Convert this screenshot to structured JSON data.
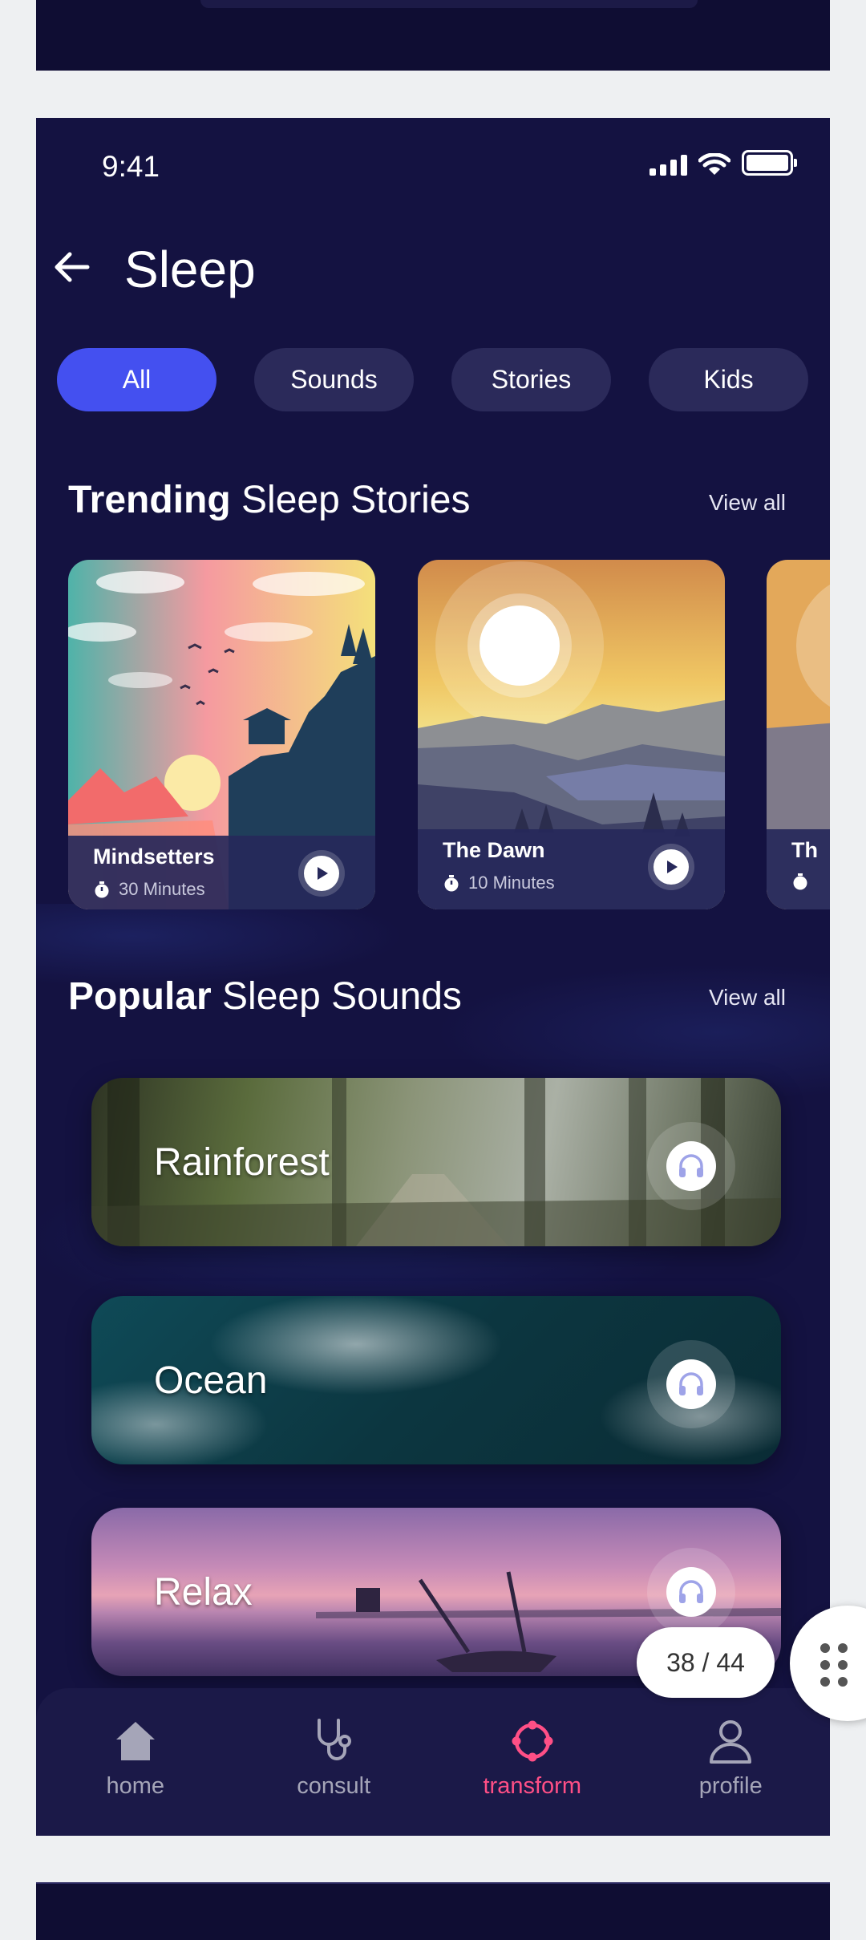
{
  "status": {
    "time": "9:41"
  },
  "header": {
    "title": "Sleep"
  },
  "chips": [
    {
      "label": "All",
      "active": true
    },
    {
      "label": "Sounds"
    },
    {
      "label": "Stories"
    },
    {
      "label": "Kids"
    }
  ],
  "trending": {
    "title_bold": "Trending",
    "title_rest": " Sleep Stories",
    "view_all": "View all",
    "items": [
      {
        "title": "Mindsetters",
        "duration": "30 Minutes"
      },
      {
        "title": "The Dawn",
        "duration": "10 Minutes"
      },
      {
        "title": "Th"
      }
    ]
  },
  "popular": {
    "title_bold": "Popular",
    "title_rest": " Sleep Sounds",
    "view_all": "View all",
    "items": [
      {
        "label": "Rainforest"
      },
      {
        "label": "Ocean"
      },
      {
        "label": "Relax"
      }
    ]
  },
  "pager": {
    "text": "38 / 44"
  },
  "nav": [
    {
      "label": "home",
      "icon": "home-icon"
    },
    {
      "label": "consult",
      "icon": "stethoscope-icon"
    },
    {
      "label": "transform",
      "icon": "transform-icon",
      "active": true
    },
    {
      "label": "profile",
      "icon": "profile-icon"
    }
  ],
  "colors": {
    "background": "#141241",
    "accent": "#4450f0",
    "active_nav": "#ff4f86"
  }
}
